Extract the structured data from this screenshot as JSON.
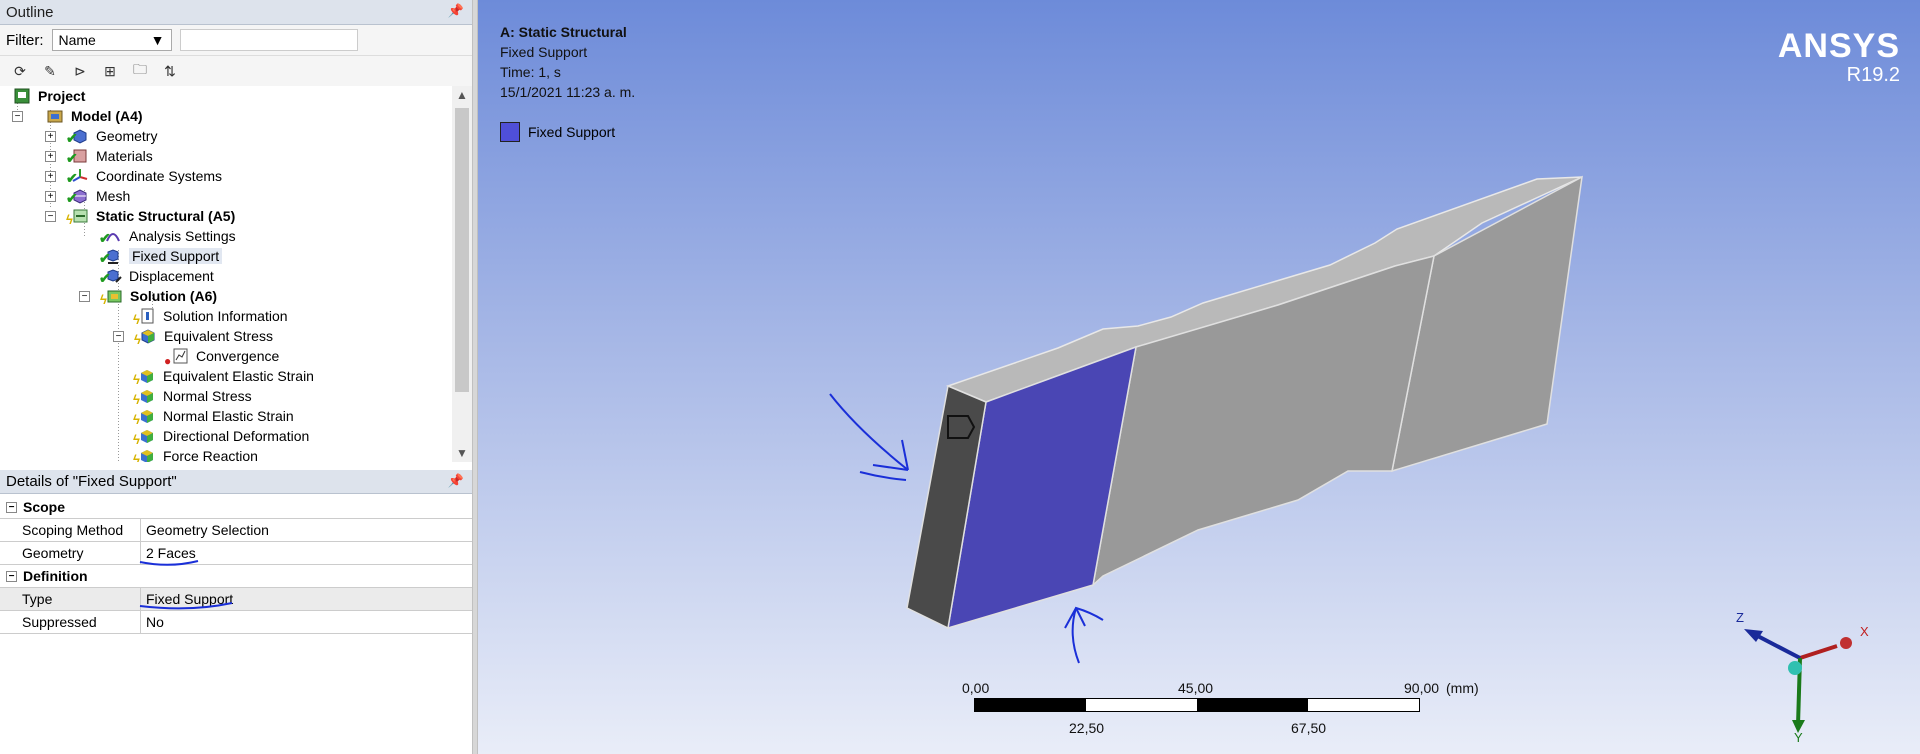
{
  "outline": {
    "title": "Outline",
    "filter_label": "Filter:",
    "filter_value": "Name",
    "tree": {
      "project": "Project",
      "model": "Model (A4)",
      "geometry": "Geometry",
      "materials": "Materials",
      "coordinate_systems": "Coordinate Systems",
      "mesh": "Mesh",
      "static_structural": "Static Structural (A5)",
      "analysis_settings": "Analysis Settings",
      "fixed_support": "Fixed Support",
      "displacement": "Displacement",
      "solution": "Solution (A6)",
      "solution_information": "Solution Information",
      "equivalent_stress": "Equivalent Stress",
      "convergence": "Convergence",
      "equivalent_elastic_strain": "Equivalent Elastic Strain",
      "normal_stress": "Normal Stress",
      "normal_elastic_strain": "Normal Elastic Strain",
      "directional_deformation": "Directional Deformation",
      "force_reaction": "Force Reaction"
    }
  },
  "details": {
    "title": "Details of \"Fixed Support\"",
    "scope_section": "Scope",
    "scoping_method_key": "Scoping Method",
    "scoping_method_val": "Geometry Selection",
    "geometry_key": "Geometry",
    "geometry_val": "2 Faces",
    "definition_section": "Definition",
    "type_key": "Type",
    "type_val": "Fixed Support",
    "suppressed_key": "Suppressed",
    "suppressed_val": "No"
  },
  "viewport": {
    "analysis": "A: Static Structural",
    "object": "Fixed Support",
    "time": "Time: 1, s",
    "date": "15/1/2021 11:23 a. m.",
    "legend_label": "Fixed Support",
    "legend_color": "#4f4fd8",
    "brand": "ANSYS",
    "version": "R19.2",
    "scale_top_left": "0,00",
    "scale_top_mid": "45,00",
    "scale_top_right": "90,00",
    "scale_unit": "(mm)",
    "scale_bottom_left": "22,50",
    "scale_bottom_right": "67,50",
    "axis_x": "X",
    "axis_y": "Y",
    "axis_z": "Z"
  }
}
